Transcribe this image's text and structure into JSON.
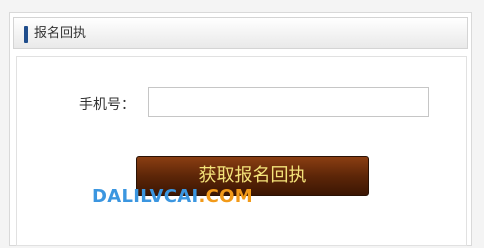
{
  "panel": {
    "title": "报名回执"
  },
  "form": {
    "phone_label": "手机号：",
    "phone_value": "",
    "phone_placeholder": "",
    "submit_label": "获取报名回执"
  },
  "watermark": {
    "part1": "DALILVCAI",
    "part2": ".COM"
  },
  "colors": {
    "header_mark": "#1f4d8c",
    "button_bg": "#5d2608",
    "button_text": "#f4e37a"
  }
}
